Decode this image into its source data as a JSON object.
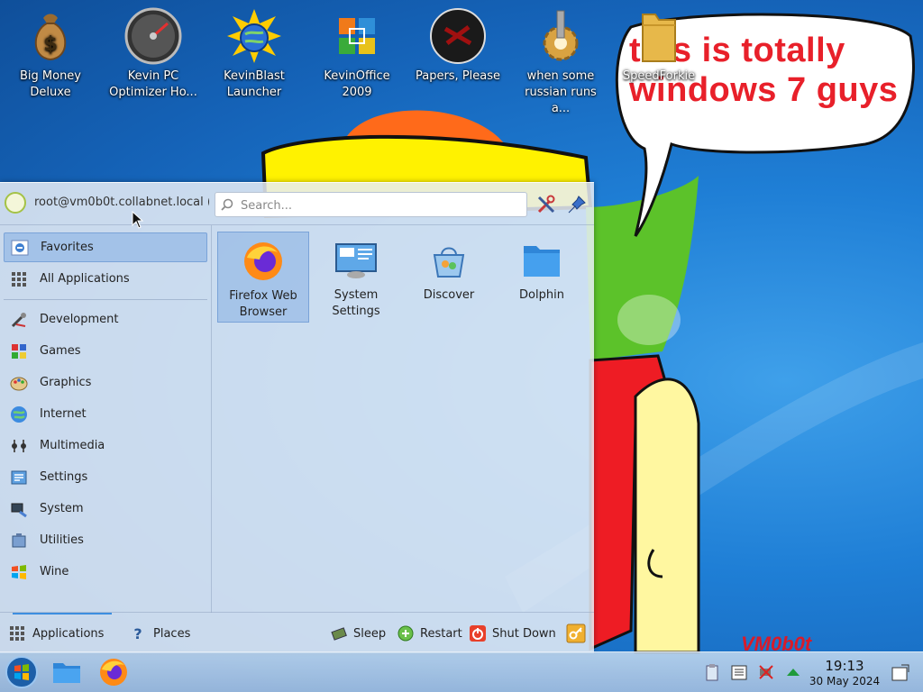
{
  "desktop": {
    "icons": [
      {
        "label": "Big Money\nDeluxe",
        "icon": "money-bag-icon"
      },
      {
        "label": "Kevin PC\nOptimizer Ho...",
        "icon": "gauge-icon"
      },
      {
        "label": "KevinBlast\nLauncher",
        "icon": "blast-globe-icon"
      },
      {
        "label": "KevinOffice\n2009",
        "icon": "office-icon"
      },
      {
        "label": "Papers, Please",
        "icon": "papers-please-icon"
      },
      {
        "label": "when some\nrussian runs a...",
        "icon": "gear-icon"
      },
      {
        "label": "SpeedForkie",
        "icon": "folder-icon"
      }
    ]
  },
  "wallpaper": {
    "speech_text": "this is totally windows 7 guys",
    "signature": "VM0b0t"
  },
  "menu": {
    "user": "root@vm0b0t.collabnet.local (...",
    "search_placeholder": "Search...",
    "header_buttons": [
      "configure-icon",
      "pin-icon"
    ],
    "categories": [
      {
        "label": "Favorites",
        "icon": "star-icon",
        "selected": true
      },
      {
        "label": "All Applications",
        "icon": "grid-icon"
      },
      {
        "label": "Development",
        "icon": "development-icon"
      },
      {
        "label": "Games",
        "icon": "games-icon"
      },
      {
        "label": "Graphics",
        "icon": "graphics-icon"
      },
      {
        "label": "Internet",
        "icon": "internet-icon"
      },
      {
        "label": "Multimedia",
        "icon": "multimedia-icon"
      },
      {
        "label": "Settings",
        "icon": "settings-icon"
      },
      {
        "label": "System",
        "icon": "system-icon"
      },
      {
        "label": "Utilities",
        "icon": "utilities-icon"
      },
      {
        "label": "Wine",
        "icon": "wine-icon"
      }
    ],
    "apps": [
      {
        "label": "Firefox Web\nBrowser",
        "icon": "firefox-icon",
        "selected": true
      },
      {
        "label": "System\nSettings",
        "icon": "system-settings-icon"
      },
      {
        "label": "Discover",
        "icon": "discover-icon"
      },
      {
        "label": "Dolphin",
        "icon": "dolphin-folder-icon"
      }
    ],
    "footer": {
      "applications": "Applications",
      "places": "Places",
      "sleep": "Sleep",
      "restart": "Restart",
      "shutdown": "Shut Down"
    }
  },
  "taskbar": {
    "time": "19:13",
    "date": "30 May 2024"
  }
}
